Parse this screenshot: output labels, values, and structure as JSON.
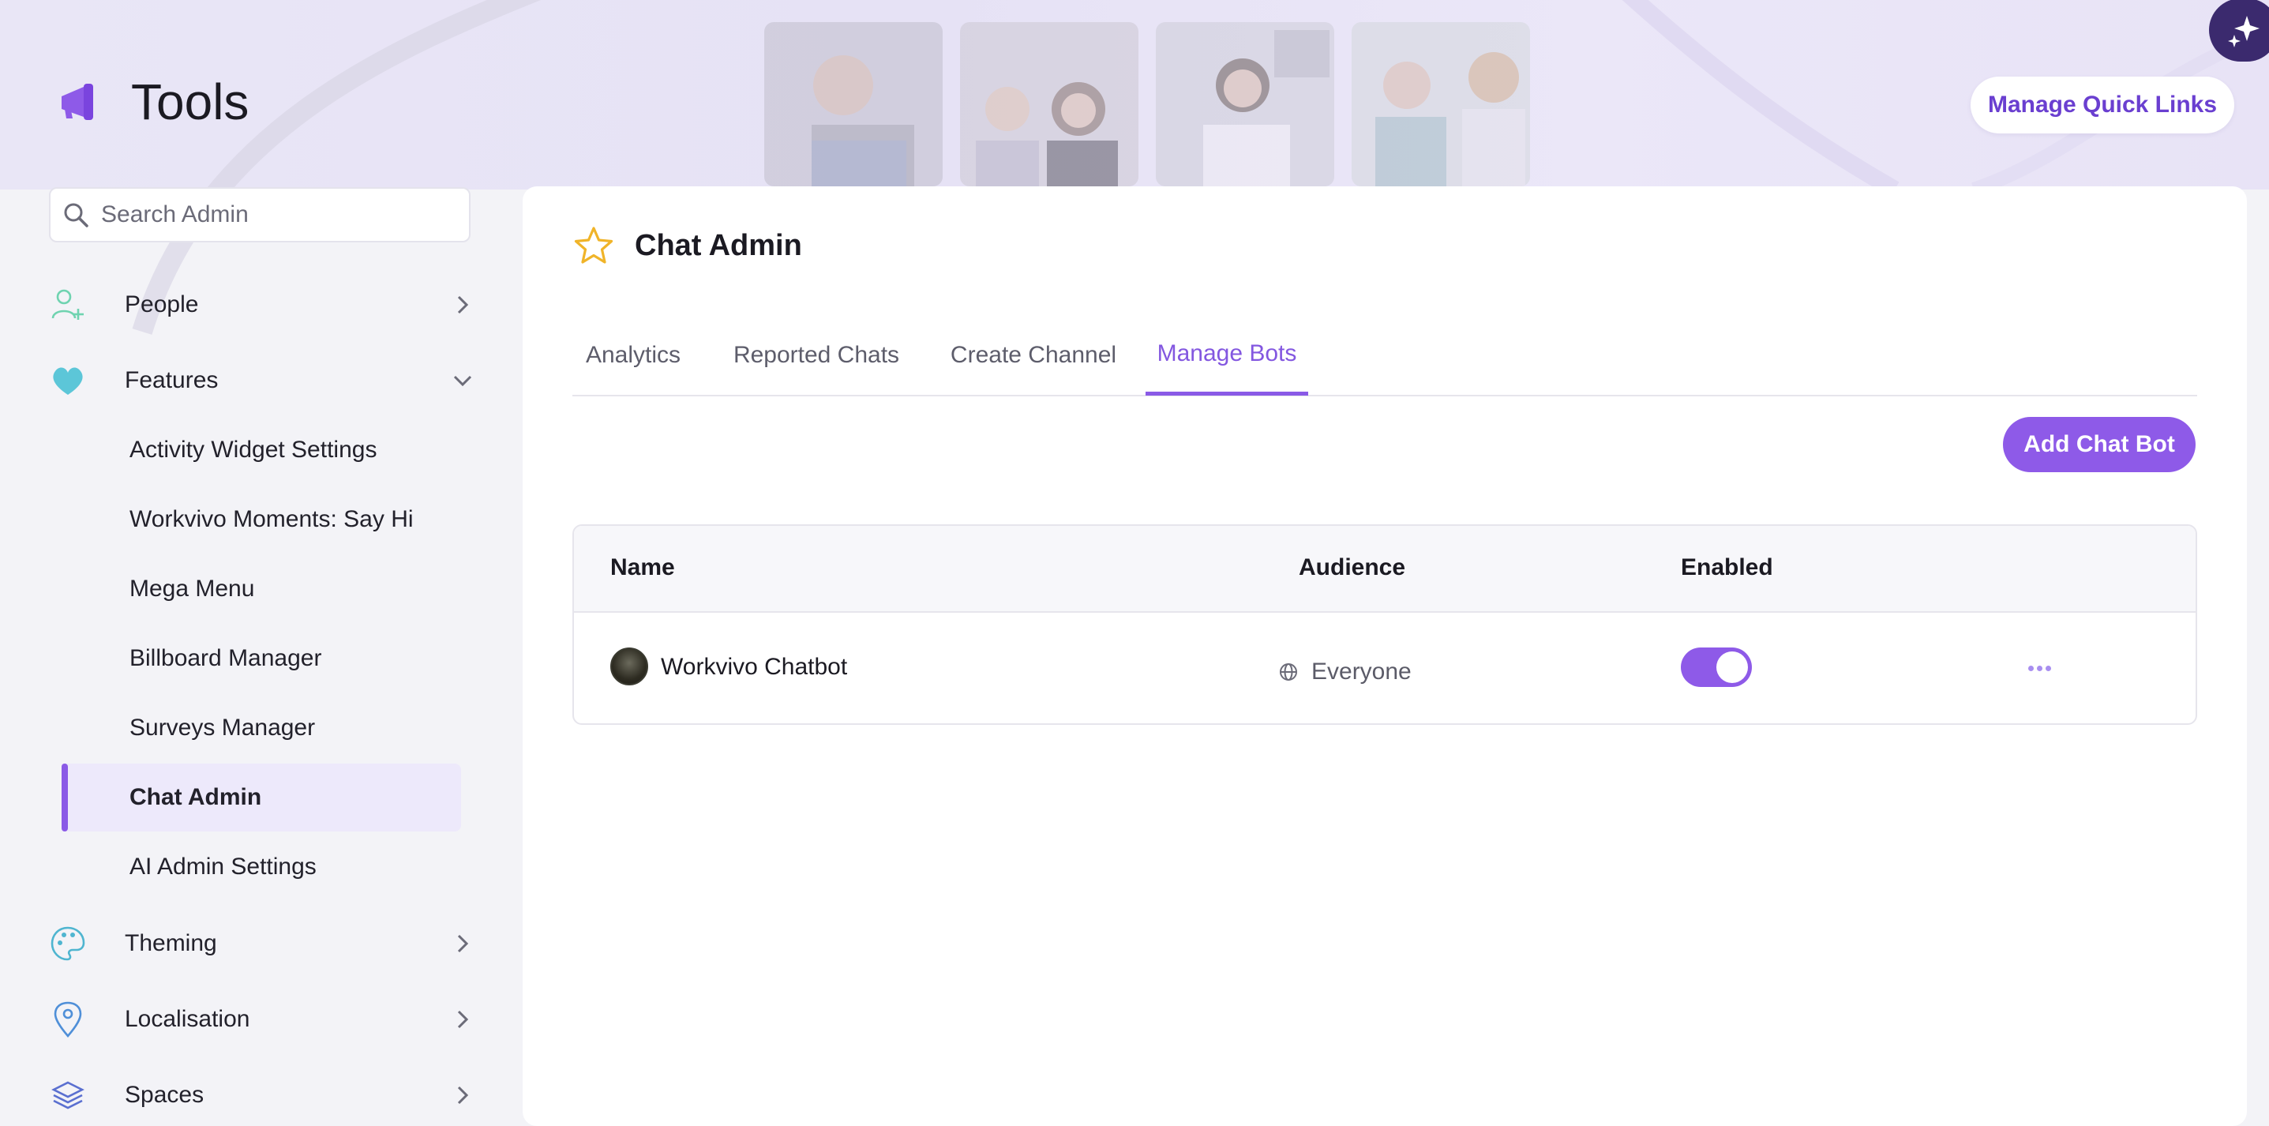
{
  "header": {
    "title": "Tools",
    "manage_quick_links": "Manage Quick Links"
  },
  "sidebar": {
    "search_placeholder": "Search Admin",
    "items": [
      {
        "label": "People",
        "icon": "person-add-icon",
        "expanded": false
      },
      {
        "label": "Features",
        "icon": "heart-icon",
        "expanded": true
      },
      {
        "label": "Theming",
        "icon": "palette-icon",
        "expanded": false
      },
      {
        "label": "Localisation",
        "icon": "location-pin-icon",
        "expanded": false
      },
      {
        "label": "Spaces",
        "icon": "layers-icon",
        "expanded": false
      }
    ],
    "feature_subitems": [
      {
        "label": "Activity Widget Settings"
      },
      {
        "label": "Workvivo Moments: Say Hi"
      },
      {
        "label": "Mega Menu"
      },
      {
        "label": "Billboard Manager"
      },
      {
        "label": "Surveys Manager"
      },
      {
        "label": "Chat Admin",
        "active": true
      },
      {
        "label": "AI Admin Settings"
      }
    ]
  },
  "main": {
    "title": "Chat Admin",
    "tabs": [
      {
        "label": "Analytics"
      },
      {
        "label": "Reported Chats"
      },
      {
        "label": "Create Channel"
      },
      {
        "label": "Manage Bots",
        "active": true
      }
    ],
    "add_button": "Add Chat Bot",
    "table": {
      "columns": [
        "Name",
        "Audience",
        "Enabled"
      ],
      "rows": [
        {
          "name": "Workvivo Chatbot",
          "audience": "Everyone",
          "enabled": true
        }
      ]
    }
  },
  "colors": {
    "accent": "#8e5ae8",
    "accent_text": "#6a3fd0",
    "star": "#f0b429",
    "people_icon": "#6fd3b0",
    "heart_icon": "#5cc6d8"
  }
}
